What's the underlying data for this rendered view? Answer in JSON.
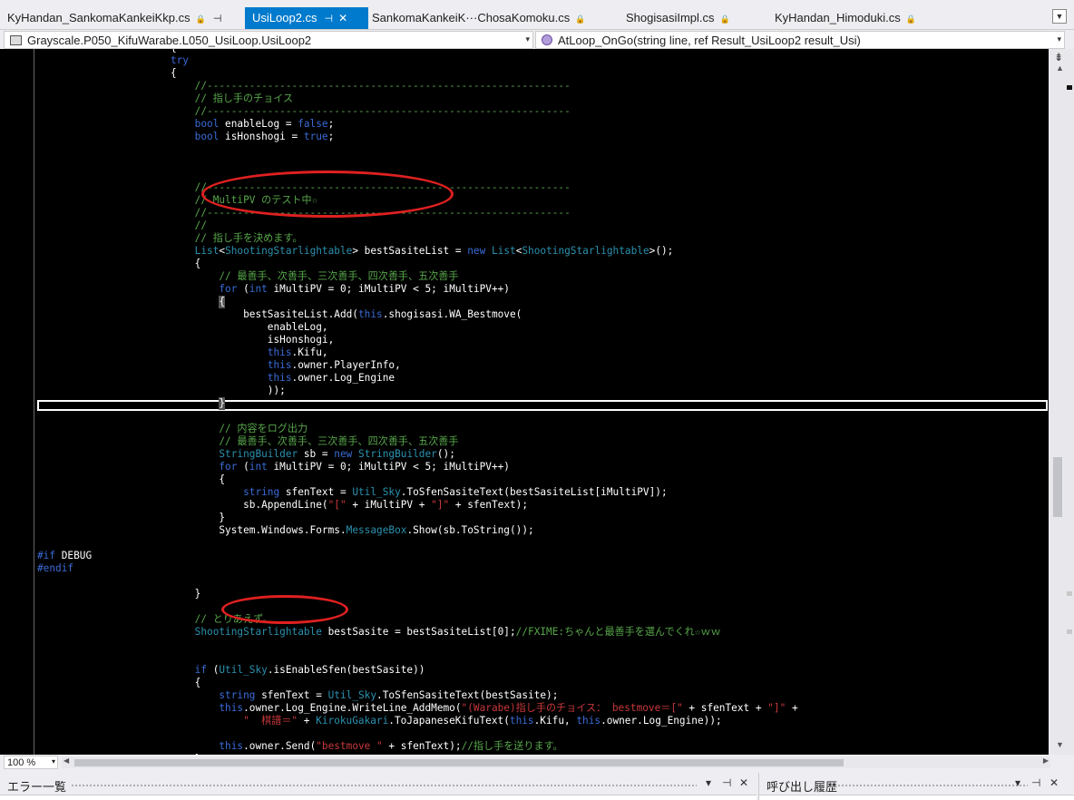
{
  "tabs": [
    {
      "label": "KyHandan_SankomaKankeiKkp.cs",
      "active": false
    },
    {
      "label": "UsiLoop2.cs",
      "active": true
    },
    {
      "label": "SankomaKankeiK···ChosaKomoku.cs",
      "active": false
    },
    {
      "label": "ShogisasiImpl.cs",
      "active": false
    },
    {
      "label": "KyHandan_Himoduki.cs",
      "active": false
    }
  ],
  "navbar": {
    "type_combo": "Grayscale.P050_KifuWarabe.L050_UsiLoop.UsiLoop2",
    "member_combo": "AtLoop_OnGo(string line, ref Result_UsiLoop2 result_Usi)"
  },
  "colors": {
    "keyword": "#3a6bd6",
    "type": "#2b91af",
    "comment": "#57a64a",
    "string": "#c8383c",
    "annotation": "#e02020",
    "active_tab": "#007acc"
  },
  "code_lines": [
    {
      "t": [
        [
          "                      {",
          ""
        ]
      ]
    },
    {
      "t": [
        [
          "                      ",
          ""
        ],
        [
          "try",
          "kw"
        ]
      ]
    },
    {
      "t": [
        [
          "                      {",
          ""
        ]
      ]
    },
    {
      "t": [
        [
          "                          ",
          ""
        ],
        [
          "//------------------------------------------------------------",
          "cm"
        ]
      ]
    },
    {
      "t": [
        [
          "                          ",
          ""
        ],
        [
          "// 指し手のチョイス",
          "cm"
        ]
      ]
    },
    {
      "t": [
        [
          "                          ",
          ""
        ],
        [
          "//------------------------------------------------------------",
          "cm"
        ]
      ]
    },
    {
      "t": [
        [
          "                          ",
          ""
        ],
        [
          "bool",
          "kw"
        ],
        [
          " enableLog = ",
          ""
        ],
        [
          "false",
          "kw"
        ],
        [
          ";",
          ""
        ]
      ]
    },
    {
      "t": [
        [
          "                          ",
          ""
        ],
        [
          "bool",
          "kw"
        ],
        [
          " isHonshogi = ",
          ""
        ],
        [
          "true",
          "kw"
        ],
        [
          ";",
          ""
        ]
      ]
    },
    {
      "t": [
        [
          "",
          ""
        ]
      ]
    },
    {
      "t": [
        [
          "",
          ""
        ]
      ]
    },
    {
      "t": [
        [
          "",
          ""
        ]
      ]
    },
    {
      "t": [
        [
          "                          ",
          ""
        ],
        [
          "//------------------------------------------------------------",
          "cm"
        ]
      ]
    },
    {
      "t": [
        [
          "                          ",
          ""
        ],
        [
          "// MultiPV のテスト中☆",
          "cm"
        ]
      ]
    },
    {
      "t": [
        [
          "                          ",
          ""
        ],
        [
          "//------------------------------------------------------------",
          "cm"
        ]
      ]
    },
    {
      "t": [
        [
          "                          ",
          ""
        ],
        [
          "//",
          "cm"
        ]
      ]
    },
    {
      "t": [
        [
          "                          ",
          ""
        ],
        [
          "// 指し手を決めます。",
          "cm"
        ]
      ]
    },
    {
      "t": [
        [
          "                          ",
          ""
        ],
        [
          "List",
          "ty"
        ],
        [
          "<",
          ""
        ],
        [
          "ShootingStarlightable",
          "ty"
        ],
        [
          "> bestSasiteList = ",
          ""
        ],
        [
          "new",
          "kw"
        ],
        [
          " ",
          ""
        ],
        [
          "List",
          "ty"
        ],
        [
          "<",
          ""
        ],
        [
          "ShootingStarlightable",
          "ty"
        ],
        [
          ">();",
          ""
        ]
      ]
    },
    {
      "t": [
        [
          "                          {",
          ""
        ]
      ]
    },
    {
      "t": [
        [
          "                              ",
          ""
        ],
        [
          "// 最善手、次善手、三次善手、四次善手、五次善手",
          "cm"
        ]
      ]
    },
    {
      "t": [
        [
          "                              ",
          ""
        ],
        [
          "for",
          "kw"
        ],
        [
          " (",
          ""
        ],
        [
          "int",
          "kw"
        ],
        [
          " iMultiPV = 0; iMultiPV < 5; iMultiPV++)",
          ""
        ]
      ]
    },
    {
      "t": [
        [
          "                              ",
          ""
        ],
        [
          "{",
          "hl"
        ]
      ]
    },
    {
      "t": [
        [
          "                                  bestSasiteList.Add(",
          ""
        ],
        [
          "this",
          "kw"
        ],
        [
          ".shogisasi.WA_Bestmove(",
          ""
        ]
      ]
    },
    {
      "t": [
        [
          "                                      enableLog,",
          ""
        ]
      ]
    },
    {
      "t": [
        [
          "                                      isHonshogi,",
          ""
        ]
      ]
    },
    {
      "t": [
        [
          "                                      ",
          ""
        ],
        [
          "this",
          "kw"
        ],
        [
          ".Kifu,",
          ""
        ]
      ]
    },
    {
      "t": [
        [
          "                                      ",
          ""
        ],
        [
          "this",
          "kw"
        ],
        [
          ".owner.PlayerInfo,",
          ""
        ]
      ]
    },
    {
      "t": [
        [
          "                                      ",
          ""
        ],
        [
          "this",
          "kw"
        ],
        [
          ".owner.Log_Engine",
          ""
        ]
      ]
    },
    {
      "t": [
        [
          "                                      ));",
          ""
        ]
      ]
    },
    {
      "t": [
        [
          "                              ",
          ""
        ],
        [
          "}",
          "hl"
        ]
      ]
    },
    {
      "t": [
        [
          "",
          ""
        ]
      ]
    },
    {
      "t": [
        [
          "                              ",
          ""
        ],
        [
          "// 内容をログ出力",
          "cm"
        ]
      ]
    },
    {
      "t": [
        [
          "                              ",
          ""
        ],
        [
          "// 最善手、次善手、三次善手、四次善手、五次善手",
          "cm"
        ]
      ]
    },
    {
      "t": [
        [
          "                              ",
          ""
        ],
        [
          "StringBuilder",
          "ty"
        ],
        [
          " sb = ",
          ""
        ],
        [
          "new",
          "kw"
        ],
        [
          " ",
          ""
        ],
        [
          "StringBuilder",
          "ty"
        ],
        [
          "();",
          ""
        ]
      ]
    },
    {
      "t": [
        [
          "                              ",
          ""
        ],
        [
          "for",
          "kw"
        ],
        [
          " (",
          ""
        ],
        [
          "int",
          "kw"
        ],
        [
          " iMultiPV = 0; iMultiPV < 5; iMultiPV++)",
          ""
        ]
      ]
    },
    {
      "t": [
        [
          "                              {",
          ""
        ]
      ]
    },
    {
      "t": [
        [
          "                                  ",
          ""
        ],
        [
          "string",
          "kw"
        ],
        [
          " sfenText = ",
          ""
        ],
        [
          "Util_Sky",
          "ty"
        ],
        [
          ".ToSfenSasiteText(bestSasiteList[iMultiPV]);",
          ""
        ]
      ]
    },
    {
      "t": [
        [
          "                                  sb.AppendLine(",
          ""
        ],
        [
          "\"[\"",
          "st"
        ],
        [
          " + iMultiPV + ",
          ""
        ],
        [
          "\"]\"",
          "st"
        ],
        [
          " + sfenText);",
          ""
        ]
      ]
    },
    {
      "t": [
        [
          "                              }",
          ""
        ]
      ]
    },
    {
      "t": [
        [
          "                              System.Windows.Forms.",
          ""
        ],
        [
          "MessageBox",
          "ty"
        ],
        [
          ".Show(sb.ToString());",
          ""
        ]
      ]
    },
    {
      "t": [
        [
          "",
          ""
        ]
      ]
    },
    {
      "t": [
        [
          "",
          ""
        ],
        [
          "#if",
          "pp"
        ],
        [
          " DEBUG",
          ""
        ]
      ]
    },
    {
      "t": [
        [
          "",
          ""
        ],
        [
          "#endif",
          "pp"
        ]
      ]
    },
    {
      "t": [
        [
          "",
          ""
        ]
      ]
    },
    {
      "t": [
        [
          "                          }",
          ""
        ]
      ]
    },
    {
      "t": [
        [
          "",
          ""
        ]
      ]
    },
    {
      "t": [
        [
          "                          ",
          ""
        ],
        [
          "// とりあえず。",
          "cm"
        ]
      ]
    },
    {
      "t": [
        [
          "                          ",
          ""
        ],
        [
          "ShootingStarlightable",
          "ty"
        ],
        [
          " bestSasite = bestSasiteList[0];",
          ""
        ],
        [
          "//FXIME:ちゃんと最善手を選んでくれ☆ｗｗ",
          "cm"
        ]
      ]
    },
    {
      "t": [
        [
          "",
          ""
        ]
      ]
    },
    {
      "t": [
        [
          "",
          ""
        ]
      ]
    },
    {
      "t": [
        [
          "                          ",
          ""
        ],
        [
          "if",
          "kw"
        ],
        [
          " (",
          ""
        ],
        [
          "Util_Sky",
          "ty"
        ],
        [
          ".isEnableSfen(bestSasite))",
          ""
        ]
      ]
    },
    {
      "t": [
        [
          "                          {",
          ""
        ]
      ]
    },
    {
      "t": [
        [
          "                              ",
          ""
        ],
        [
          "string",
          "kw"
        ],
        [
          " sfenText = ",
          ""
        ],
        [
          "Util_Sky",
          "ty"
        ],
        [
          ".ToSfenSasiteText(bestSasite);",
          ""
        ]
      ]
    },
    {
      "t": [
        [
          "                              ",
          ""
        ],
        [
          "this",
          "kw"
        ],
        [
          ".owner.Log_Engine.WriteLine_AddMemo(",
          ""
        ],
        [
          "\"(Warabe)指し手のチョイス： bestmove＝[\"",
          "st"
        ],
        [
          " + sfenText + ",
          ""
        ],
        [
          "\"]\"",
          "st"
        ],
        [
          " +",
          ""
        ]
      ]
    },
    {
      "t": [
        [
          "                                  ",
          ""
        ],
        [
          "\"  棋譜＝\"",
          "st"
        ],
        [
          " + ",
          ""
        ],
        [
          "KirokuGakari",
          "ty"
        ],
        [
          ".ToJapaneseKifuText(",
          ""
        ],
        [
          "this",
          "kw"
        ],
        [
          ".Kifu, ",
          ""
        ],
        [
          "this",
          "kw"
        ],
        [
          ".owner.Log_Engine));",
          ""
        ]
      ]
    },
    {
      "t": [
        [
          "",
          ""
        ]
      ]
    },
    {
      "t": [
        [
          "                              ",
          ""
        ],
        [
          "this",
          "kw"
        ],
        [
          ".owner.Send(",
          ""
        ],
        [
          "\"bestmove \"",
          "st"
        ],
        [
          " + sfenText);",
          ""
        ],
        [
          "//指し手を送ります。",
          "cm"
        ]
      ]
    },
    {
      "t": [
        [
          "                          }",
          ""
        ]
      ]
    }
  ],
  "statusbar": {
    "zoom": "100 %"
  },
  "bottom_panels": {
    "error_list_title": "エラー一覧",
    "call_hierarchy_title": "呼び出し履歴"
  }
}
